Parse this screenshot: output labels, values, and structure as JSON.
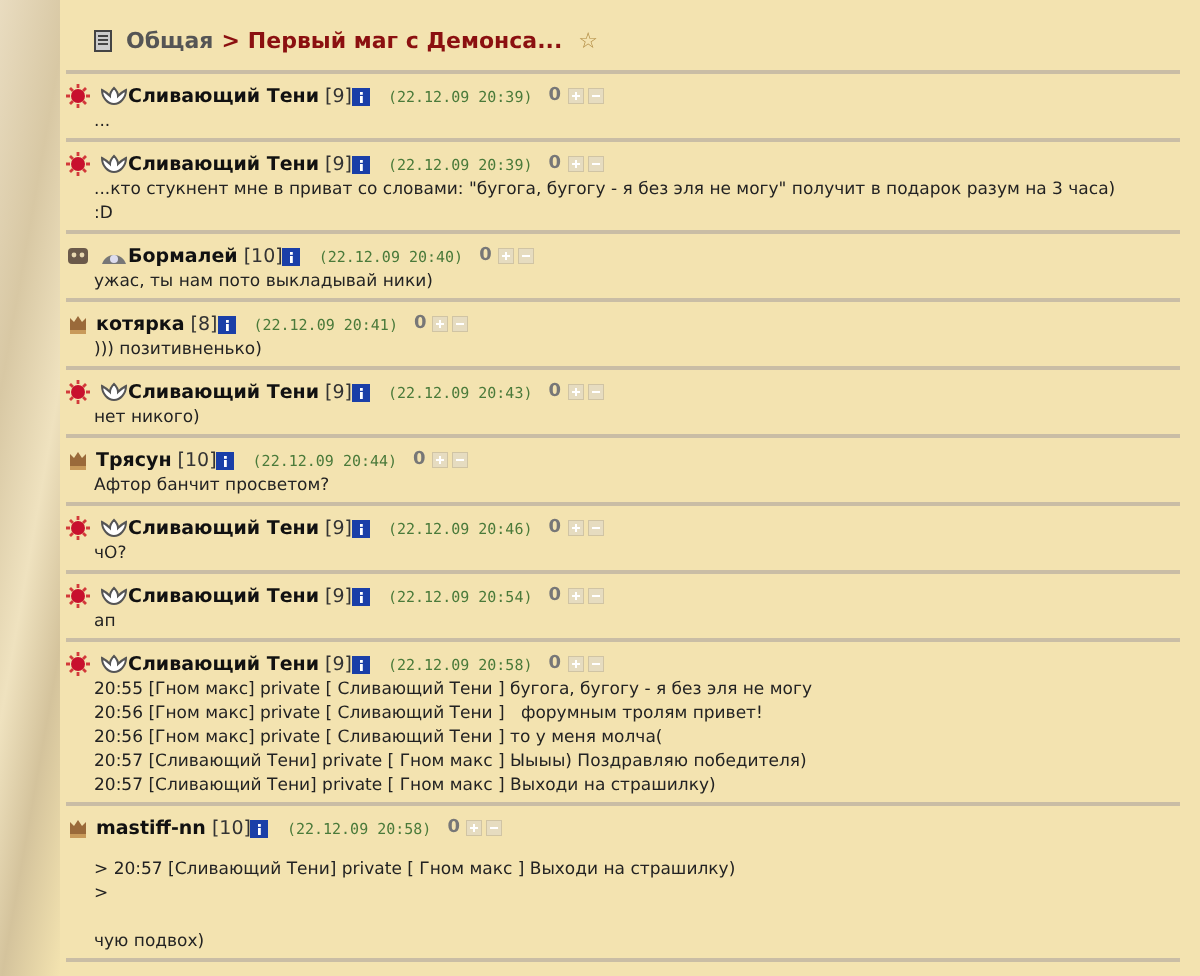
{
  "breadcrumb": {
    "section": "Общая",
    "separator": ">",
    "topic": "Первый маг с Демонса...",
    "star": "☆"
  },
  "posts": [
    {
      "emblem": {
        "kind": "sun"
      },
      "align": {
        "kind": "wings"
      },
      "name": "Сливающий Тени",
      "level": "[9]",
      "date": "(22.12.09 20:39)",
      "rating": "0",
      "text": [
        "..."
      ]
    },
    {
      "emblem": {
        "kind": "sun"
      },
      "align": {
        "kind": "wings"
      },
      "name": "Сливающий Тени",
      "level": "[9]",
      "date": "(22.12.09 20:39)",
      "rating": "0",
      "text": [
        "...кто стукнент мне в приват со словами: \"бугога, бугогу - я без эля не могу\" получит в подарок разум на 3 часа)",
        ":D"
      ]
    },
    {
      "emblem": {
        "kind": "skull"
      },
      "align": {
        "kind": "eye"
      },
      "name": "Бормалей",
      "level": "[10]",
      "date": "(22.12.09 20:40)",
      "rating": "0",
      "text": [
        "ужас, ты нам пото выкладывай ники)"
      ]
    },
    {
      "emblem": {
        "kind": "crest"
      },
      "name": "котярка",
      "level": "[8]",
      "date": "(22.12.09 20:41)",
      "rating": "0",
      "text": [
        "))) позитивненько)"
      ]
    },
    {
      "emblem": {
        "kind": "sun"
      },
      "align": {
        "kind": "wings"
      },
      "name": "Сливающий Тени",
      "level": "[9]",
      "date": "(22.12.09 20:43)",
      "rating": "0",
      "text": [
        "нет никого)"
      ]
    },
    {
      "emblem": {
        "kind": "crest"
      },
      "name": "Трясун",
      "level": "[10]",
      "date": "(22.12.09 20:44)",
      "rating": "0",
      "text": [
        "Афтор банчит просветом?"
      ]
    },
    {
      "emblem": {
        "kind": "sun"
      },
      "align": {
        "kind": "wings"
      },
      "name": "Сливающий Тени",
      "level": "[9]",
      "date": "(22.12.09 20:46)",
      "rating": "0",
      "text": [
        "чО?"
      ]
    },
    {
      "emblem": {
        "kind": "sun"
      },
      "align": {
        "kind": "wings"
      },
      "name": "Сливающий Тени",
      "level": "[9]",
      "date": "(22.12.09 20:54)",
      "rating": "0",
      "text": [
        "ап"
      ]
    },
    {
      "emblem": {
        "kind": "sun"
      },
      "align": {
        "kind": "wings"
      },
      "name": "Сливающий Тени",
      "level": "[9]",
      "date": "(22.12.09 20:58)",
      "rating": "0",
      "text": [
        "20:55 [Гном макс] private [ Сливающий Тени ] бугога, бугогу - я без эля не могу",
        "20:56 [Гном макс] private [ Сливающий Тени ]   форумным тролям привет!",
        "20:56 [Гном макс] private [ Сливающий Тени ] то у меня молча(",
        "20:57 [Сливающий Тени] private [ Гном макс ] Ыыыы) Поздравляю победителя)",
        "20:57 [Сливающий Тени] private [ Гном макс ] Выходи на страшилку)"
      ]
    },
    {
      "emblem": {
        "kind": "crest"
      },
      "name": "mastiff-nn",
      "level": "[10]",
      "date": "(22.12.09 20:58)",
      "rating": "0",
      "quote": [
        "> 20:57 [Сливающий Тени] private [ Гном макс ] Выходи на страшилку)",
        ">"
      ],
      "text": [
        "чую подвох)"
      ]
    }
  ]
}
